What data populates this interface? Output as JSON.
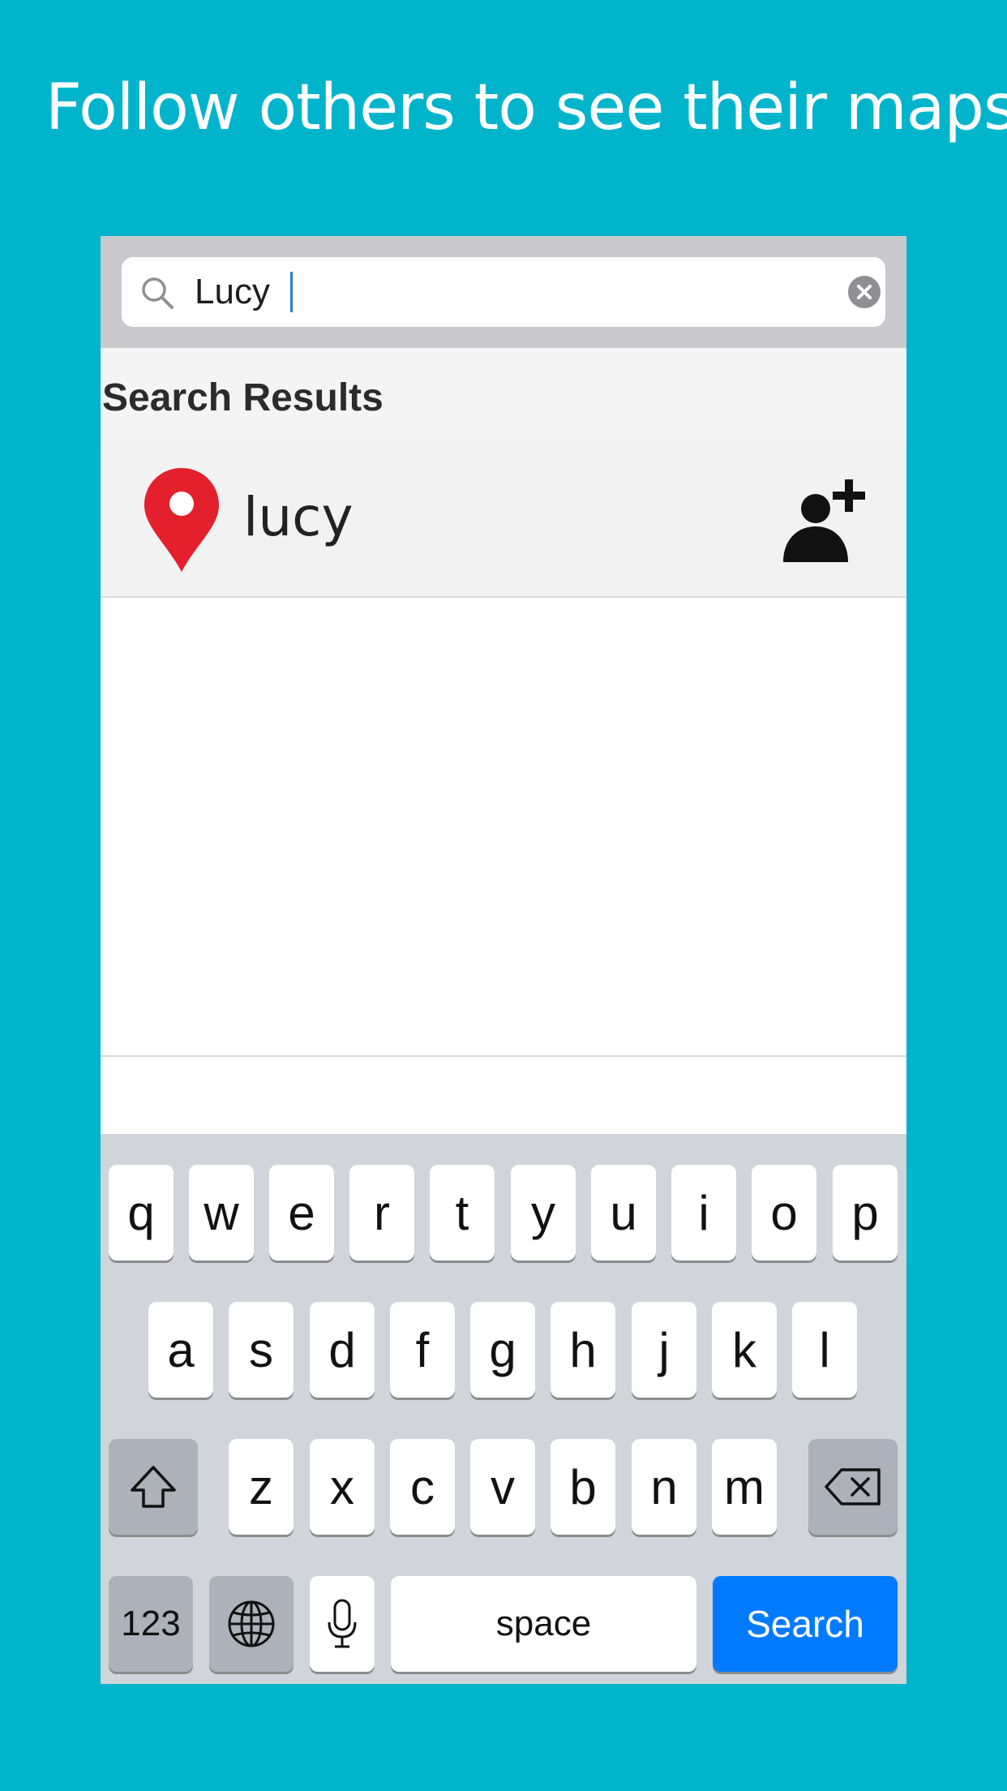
{
  "headline": "Follow others to see their maps",
  "search": {
    "value": "Lucy",
    "icon": "magnifier-icon",
    "clear_icon": "clear-icon"
  },
  "section_header": "Search Results",
  "results": [
    {
      "name": "lucy",
      "icon": "map-pin-icon",
      "action_icon": "add-user-icon"
    }
  ],
  "keyboard": {
    "row1": [
      "q",
      "w",
      "e",
      "r",
      "t",
      "y",
      "u",
      "i",
      "o",
      "p"
    ],
    "row2": [
      "a",
      "s",
      "d",
      "f",
      "g",
      "h",
      "j",
      "k",
      "l"
    ],
    "row3": [
      "z",
      "x",
      "c",
      "v",
      "b",
      "n",
      "m"
    ],
    "numbers_label": "123",
    "space_label": "space",
    "return_label": "Search"
  },
  "colors": {
    "background": "#00B4CC",
    "pin": "#E3202C",
    "return_key": "#007AFF"
  }
}
